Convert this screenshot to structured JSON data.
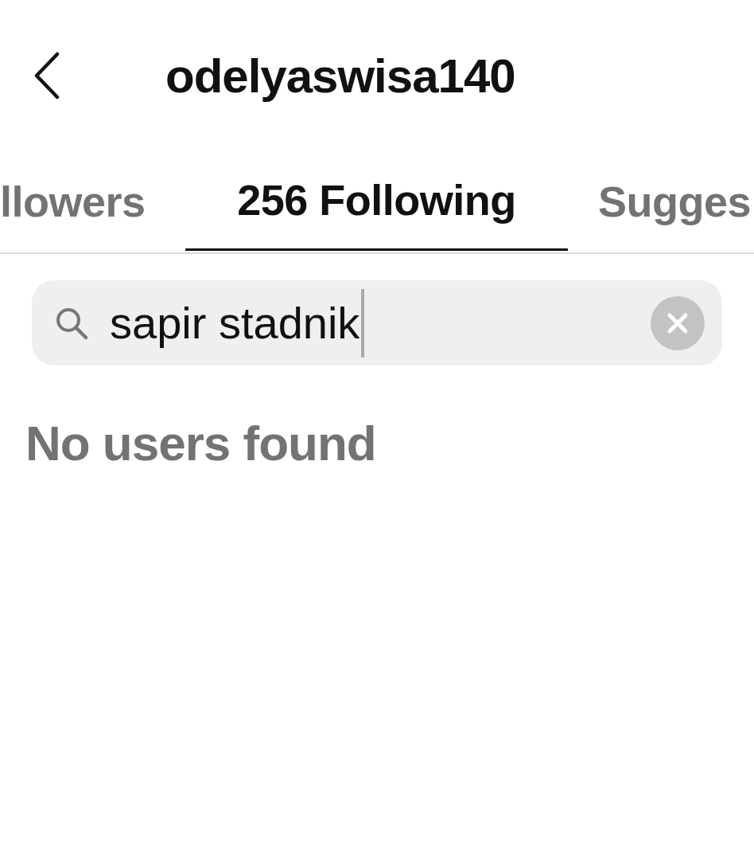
{
  "header": {
    "title": "odelyaswisa140"
  },
  "tabs": [
    {
      "label": "llowers",
      "selected": false
    },
    {
      "label": "256 Following",
      "selected": true
    },
    {
      "label": "Sugges",
      "selected": false
    }
  ],
  "search": {
    "value": "sapir stadnik"
  },
  "message": "No users found"
}
